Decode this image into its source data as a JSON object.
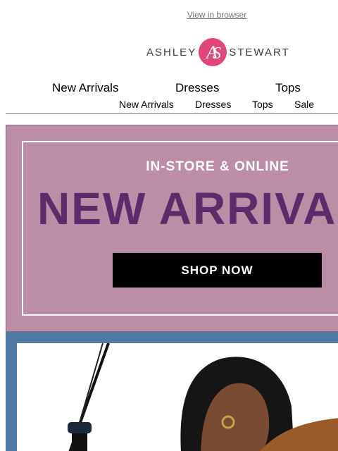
{
  "header": {
    "view_in_browser": "View in browser",
    "logo_left": "ASHLEY",
    "logo_right": "STEWART",
    "logo_mark": "AS"
  },
  "nav_primary": [
    {
      "label": "New Arrivals"
    },
    {
      "label": "Dresses"
    },
    {
      "label": "Tops"
    }
  ],
  "nav_secondary": [
    {
      "label": "New Arrivals"
    },
    {
      "label": "Dresses"
    },
    {
      "label": "Tops"
    },
    {
      "label": "Sale"
    }
  ],
  "promo": {
    "eyebrow": "IN-STORE & ONLINE",
    "title": "NEW ARRIVALS",
    "cta": "SHOP NOW",
    "bg_color": "#bb8da6",
    "title_color": "#5a2c6a"
  },
  "hero": {
    "bg_color": "#4f7aa4",
    "image": "model-photo"
  },
  "colors": {
    "brand_pink": "#e0457b"
  }
}
